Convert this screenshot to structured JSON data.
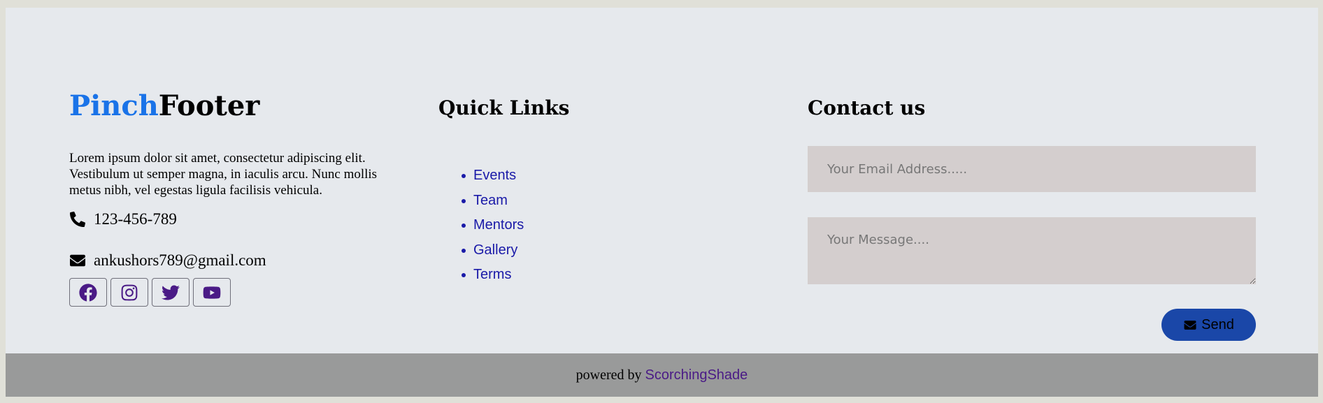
{
  "brand": {
    "accent_text": "Pinch",
    "rest_text": "Footer",
    "accent_color": "#1a73e8"
  },
  "about": {
    "description": "Lorem ipsum dolor sit amet, consectetur adipiscing elit. Vestibulum ut semper magna, in iaculis arcu. Nunc mollis metus nibh, vel egestas ligula facilisis vehicula.",
    "phone": "123-456-789",
    "phone_icon": "phone-icon",
    "email": "ankushors789@gmail.com",
    "email_icon": "envelope-icon"
  },
  "socials": [
    {
      "icon": "facebook-icon"
    },
    {
      "icon": "instagram-icon"
    },
    {
      "icon": "twitter-icon"
    },
    {
      "icon": "youtube-icon"
    }
  ],
  "quick_links": {
    "title": "Quick Links",
    "items": [
      "Events",
      "Team",
      "Mentors",
      "Gallery",
      "Terms"
    ],
    "link_color": "#1a1aa8"
  },
  "contact": {
    "title": "Contact us",
    "email_placeholder": "Your Email Address.....",
    "message_placeholder": "Your Message....",
    "send_label": "Send",
    "send_icon": "envelope-icon",
    "button_color": "#1a47a8"
  },
  "bottom": {
    "powered_by_label": "powered by",
    "powered_by_link": "ScorchingShade",
    "link_color": "#4a1a86",
    "bar_color": "#999a9a"
  }
}
